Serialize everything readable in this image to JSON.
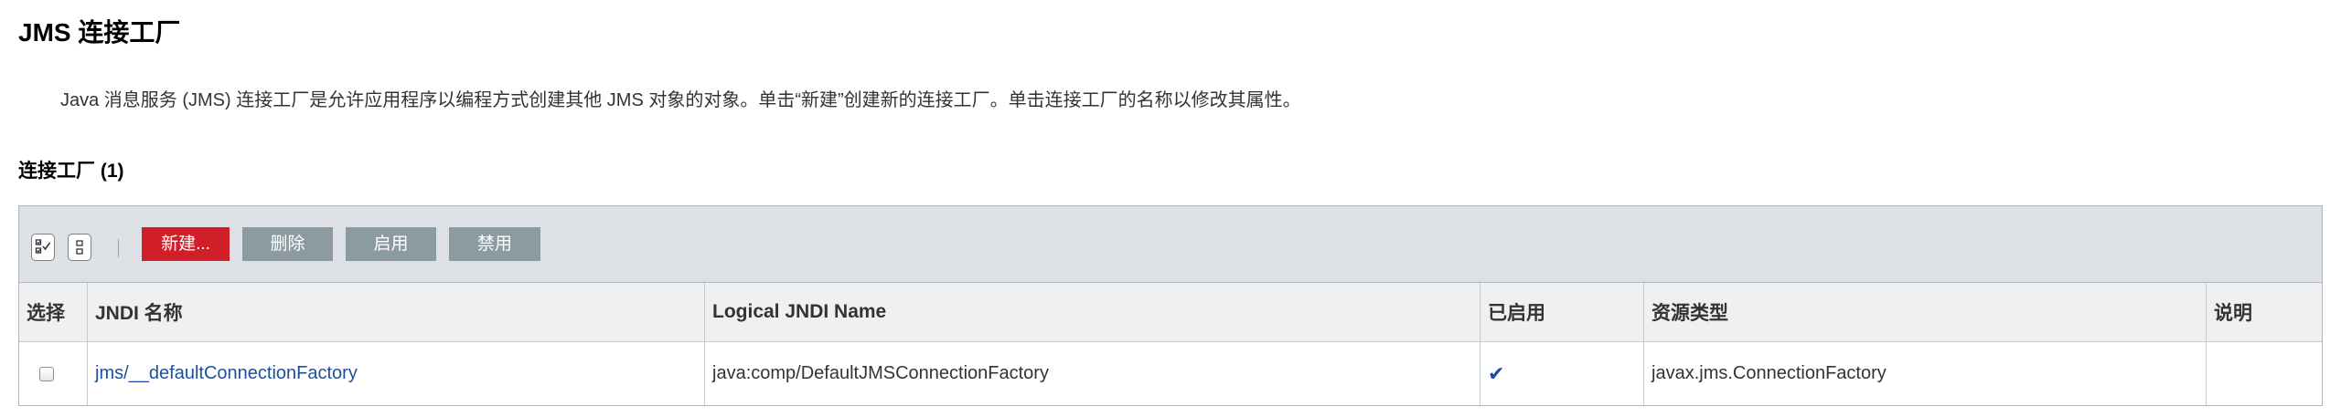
{
  "page": {
    "title": "JMS 连接工厂",
    "description": "Java 消息服务 (JMS) 连接工厂是允许应用程序以编程方式创建其他 JMS 对象的对象。单击“新建”创建新的连接工厂。单击连接工厂的名称以修改其属性。"
  },
  "section": {
    "title": "连接工厂 (1)"
  },
  "toolbar": {
    "select_all_icon": "select-all-icon",
    "deselect_all_icon": "deselect-all-icon",
    "new_label": "新建...",
    "delete_label": "删除",
    "enable_label": "启用",
    "disable_label": "禁用"
  },
  "table": {
    "columns": [
      "选择",
      "JNDI 名称",
      "Logical JNDI Name",
      "已启用",
      "资源类型",
      "说明"
    ],
    "rows": [
      {
        "selected": false,
        "jndi_name": "jms/__defaultConnectionFactory",
        "logical_jndi_name": "java:comp/DefaultJMSConnectionFactory",
        "enabled": true,
        "enabled_icon": "checkmark-icon",
        "resource_type": "javax.jms.ConnectionFactory",
        "description": ""
      }
    ]
  },
  "colors": {
    "new_button": "#d01f28",
    "grey_button": "#8c9aa2",
    "link": "#1d4e9e",
    "toolbar_bg": "#dde0e4",
    "header_bg": "#eef0f2"
  }
}
